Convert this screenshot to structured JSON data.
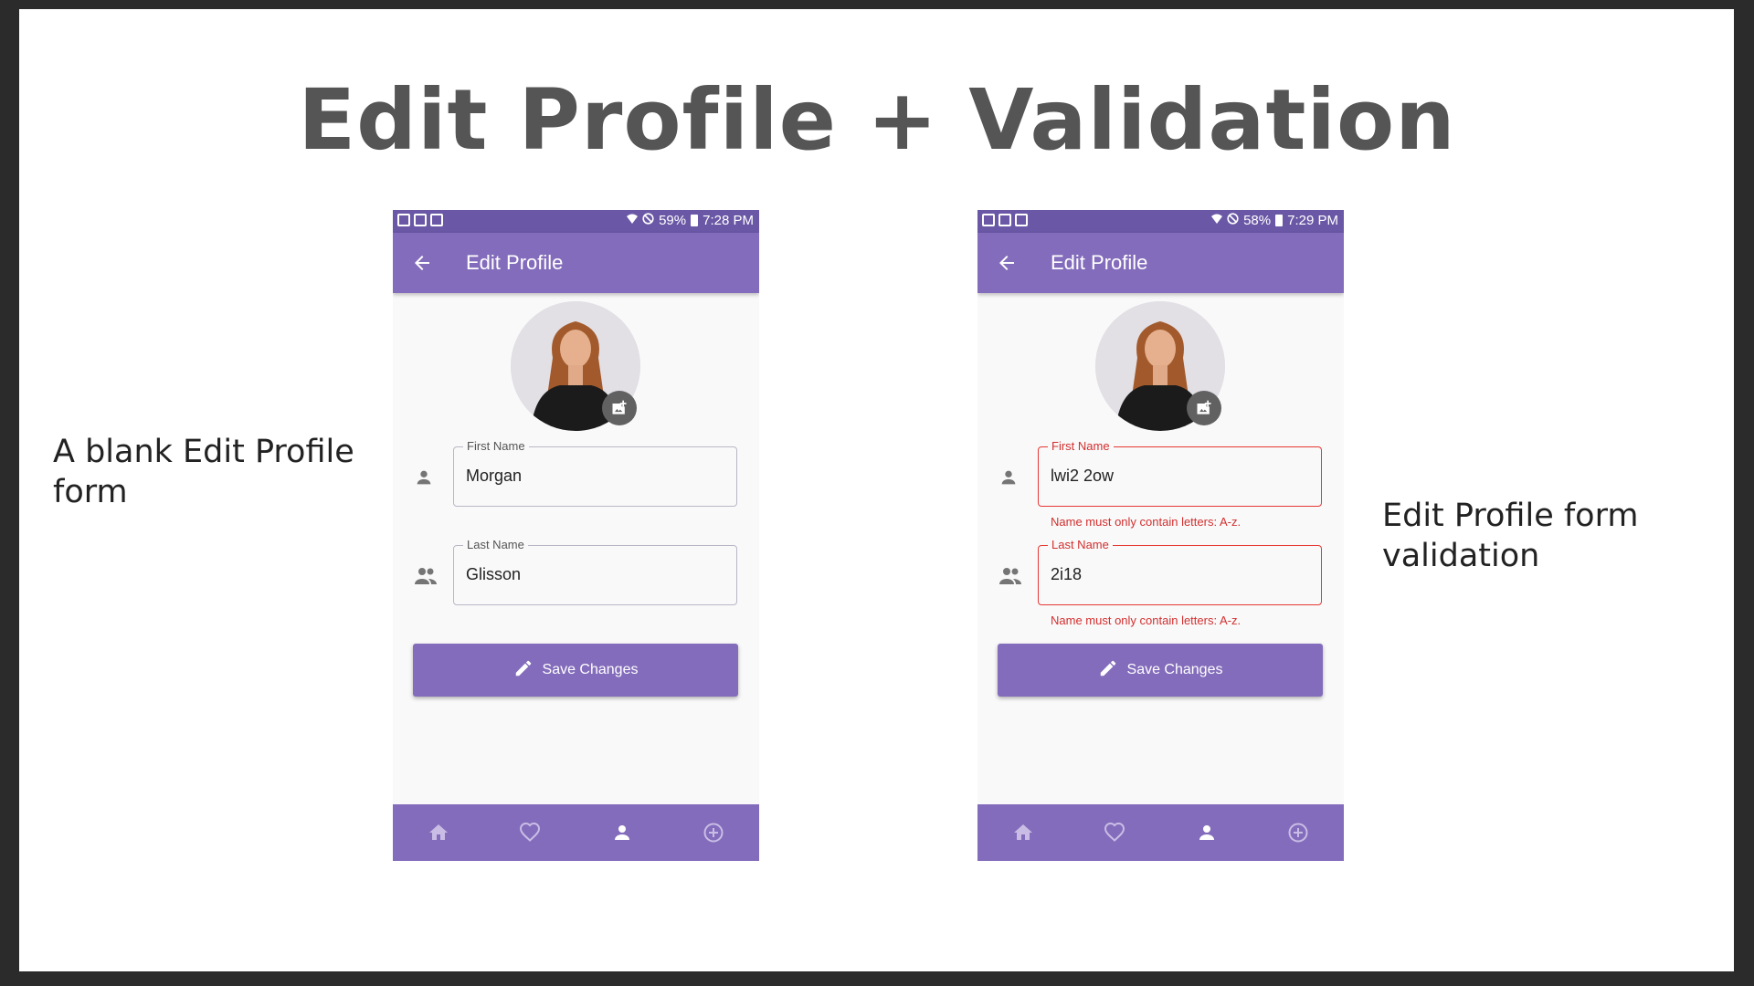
{
  "slide": {
    "title": "Edit Profile + Validation",
    "caption_left": "A blank Edit Profile form",
    "caption_right": "Edit Profile form validation"
  },
  "phones": [
    {
      "status": {
        "battery": "59%",
        "time": "7:28 PM"
      },
      "appbar_title": "Edit Profile",
      "first_name": {
        "label": "First Name",
        "value": "Morgan",
        "error": ""
      },
      "last_name": {
        "label": "Last Name",
        "value": "Glisson",
        "error": ""
      },
      "save_label": "Save Changes"
    },
    {
      "status": {
        "battery": "58%",
        "time": "7:29 PM"
      },
      "appbar_title": "Edit Profile",
      "first_name": {
        "label": "First Name",
        "value": "lwi2 2ow",
        "error": "Name must only contain letters: A-z."
      },
      "last_name": {
        "label": "Last Name",
        "value": "2i18",
        "error": "Name must only contain letters: A-z."
      },
      "save_label": "Save Changes"
    }
  ],
  "icons": {
    "back": "arrow-back-icon",
    "person": "person-icon",
    "people": "people-icon",
    "edit": "pencil-icon",
    "add_photo": "add-photo-icon",
    "nav": [
      "home-icon",
      "heart-icon",
      "profile-icon",
      "add-circle-icon"
    ]
  },
  "colors": {
    "appbar": "#836cbb",
    "statusbar": "#6a58a6",
    "error": "#d32f2f"
  }
}
